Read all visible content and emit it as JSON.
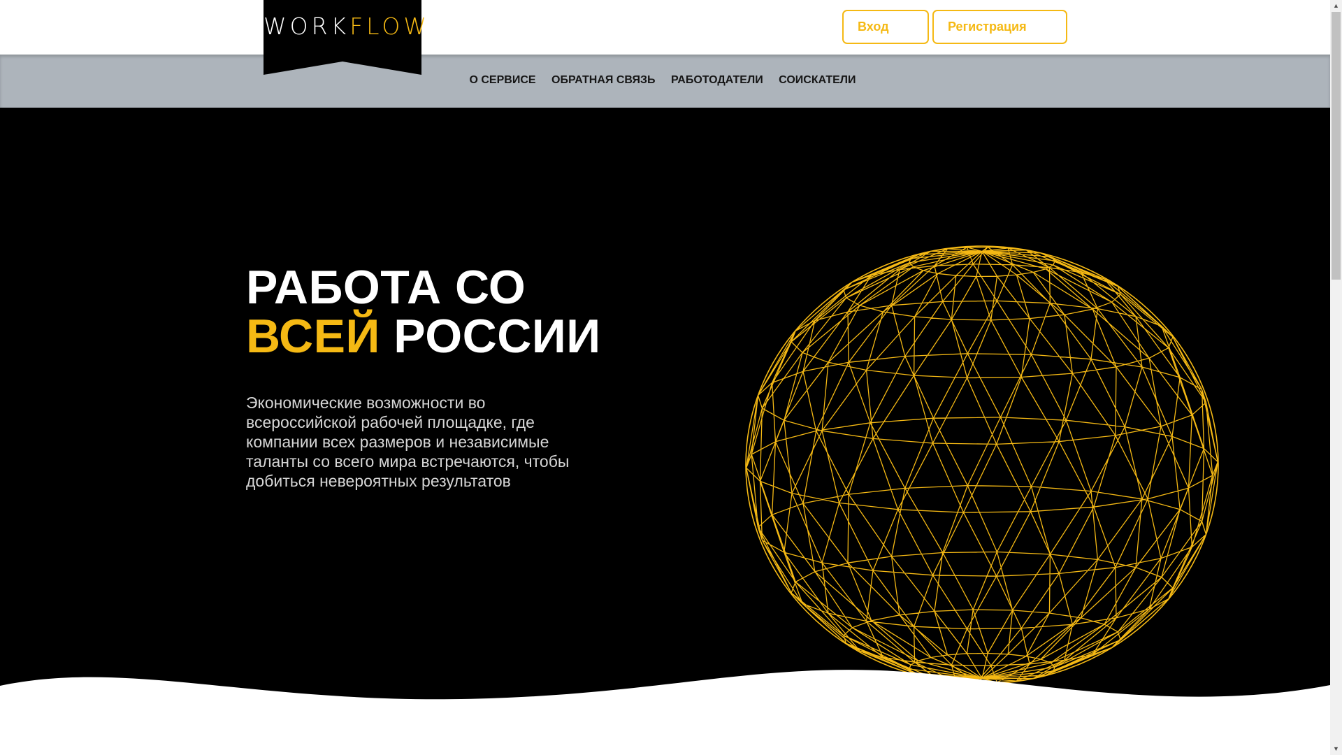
{
  "brand": {
    "logo_part1": "WORK",
    "logo_part2": "FLOW",
    "accent_color": "#f5b914",
    "nav_background": "#adb4bb",
    "hero_background": "#000000"
  },
  "header": {
    "login_label": "Вход",
    "register_label": "Регистрация"
  },
  "nav": {
    "items": [
      {
        "label": "О сервисе"
      },
      {
        "label": "Обратная связь"
      },
      {
        "label": "Работодатели"
      },
      {
        "label": "Соискатели"
      }
    ]
  },
  "hero": {
    "title_line1": "РАБОТА СО",
    "title_accent": "ВСЕЙ",
    "title_line2_rest": " РОССИИ",
    "description": "Экономические возможности во всероссийской рабочей площадке, где компании всех размеров и независимые таланты со всего мира встречаются, чтобы добиться невероятных результатов",
    "globe_icon": "wireframe-globe-icon"
  },
  "icons": {
    "scroll_up": "scroll-up-arrow-icon",
    "scroll_down": "scroll-down-arrow-icon"
  }
}
